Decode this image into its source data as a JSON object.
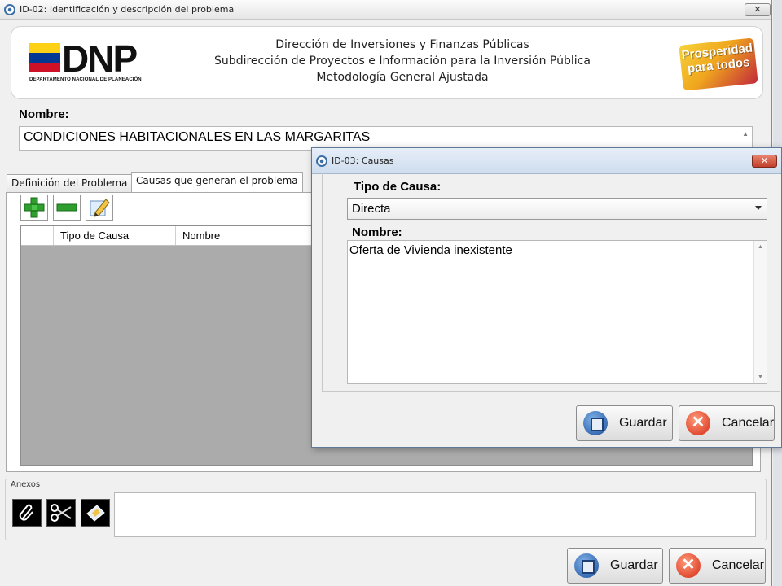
{
  "main_window": {
    "title": "ID-02: Identificación y descripción del problema",
    "close_label": "✕"
  },
  "banner": {
    "logo_text": "DNP",
    "logo_subtext": "DEPARTAMENTO NACIONAL DE PLANEACIÓN",
    "line1": "Dirección de Inversiones y Finanzas Públicas",
    "line2": "Subdirección de Proyectos e Información para la Inversión Pública",
    "line3": "Metodología General Ajustada",
    "slogan_line1": "Prosperidad",
    "slogan_line2": "para todos",
    "flag_colors": [
      "#fcd116",
      "#003893",
      "#ce1126"
    ]
  },
  "nombre": {
    "label": "Nombre:",
    "value": "CONDICIONES HABITACIONALES EN LAS MARGARITAS"
  },
  "tabs": [
    {
      "label": "Definición del Problema"
    },
    {
      "label": "Causas que generan el problema"
    }
  ],
  "toolbar": {
    "add_icon": "plus-icon",
    "remove_icon": "minus-icon",
    "edit_icon": "edit-icon"
  },
  "grid": {
    "columns": [
      "Tipo de Causa",
      "Nombre"
    ]
  },
  "anexos": {
    "label": "Anexos",
    "icons": [
      "paperclip-icon",
      "scissors-icon",
      "attachment-view-icon"
    ]
  },
  "main_buttons": {
    "save_label": "Guardar",
    "cancel_label": "Cancelar"
  },
  "dialog": {
    "title": "ID-03: Causas",
    "close_label": "✕",
    "tipo_label": "Tipo de Causa:",
    "tipo_value": "Directa",
    "nombre_label": "Nombre:",
    "nombre_value": "Oferta de Vivienda inexistente",
    "save_label": "Guardar",
    "cancel_label": "Cancelar"
  },
  "colors": {
    "grid_background": "#ababab",
    "accent_blue": "#3a6ea5",
    "cancel_red": "#d42a14"
  }
}
